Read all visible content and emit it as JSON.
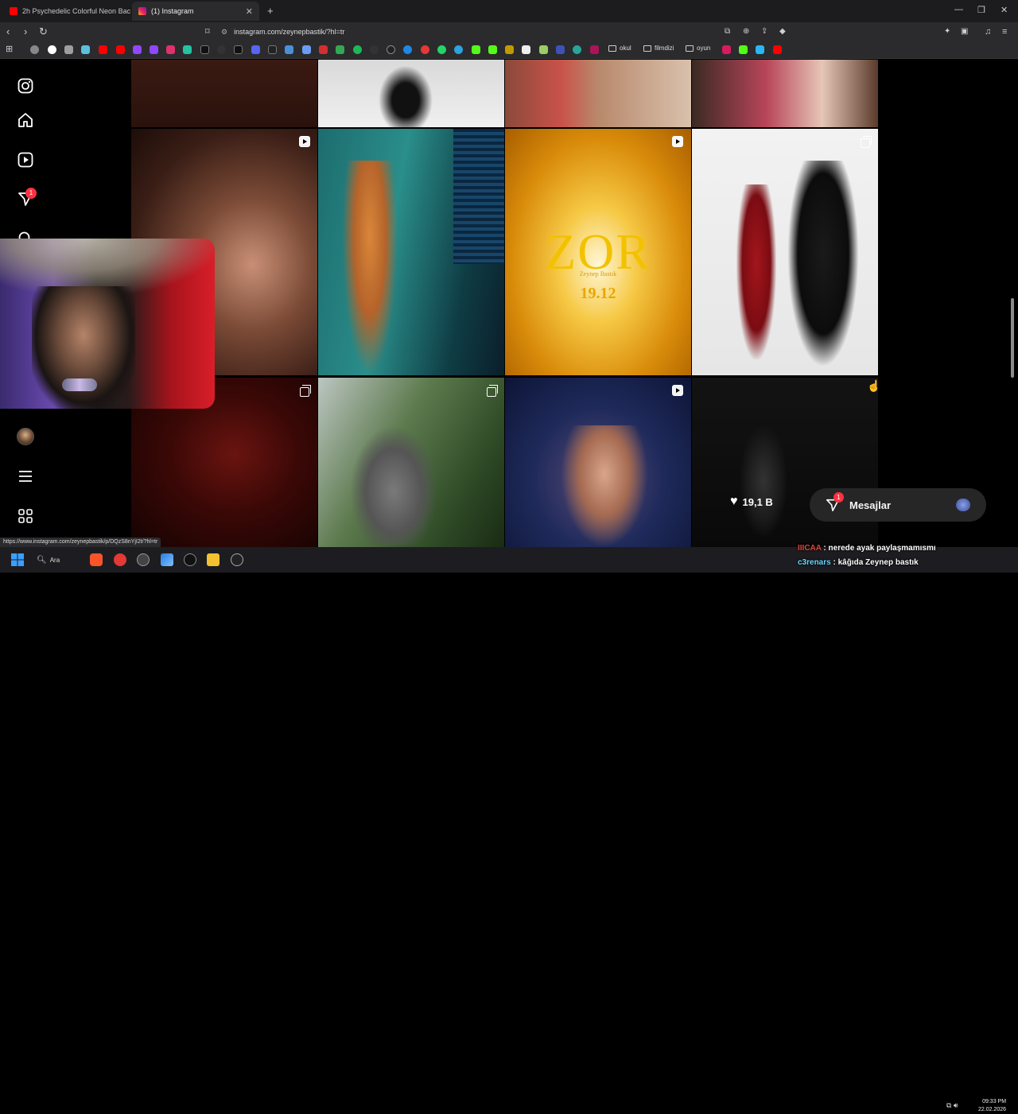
{
  "browser": {
    "tabs": [
      {
        "title": "2h Psychedelic Colorful Neon Backgr",
        "active": false
      },
      {
        "title": "(1) Instagram",
        "active": true
      }
    ],
    "url": "instagram.com/zeynepbastik/?hl=tr",
    "bookmark_folders": [
      "okul",
      "filmdizi",
      "oyun"
    ],
    "status_url": "https://www.instagram.com/zeynepbastik/p/DQzS8nYjI2t/?hl=tr"
  },
  "sidebar": {
    "notification_count": "1",
    "icons": [
      "instagram-logo-icon",
      "home-icon",
      "reels-icon",
      "messages-icon",
      "search-icon",
      "profile-avatar",
      "menu-icon",
      "apps-icon"
    ]
  },
  "grid": {
    "featured_post_title": "ZOR",
    "featured_post_subtitle": "Zeynep Bastık",
    "featured_post_date": "19.12",
    "hover_likes": "19,1 B"
  },
  "messages": {
    "label": "Mesajlar",
    "badge": "1"
  },
  "taskbar": {
    "search_label": "Ara",
    "time": "09:33 PM",
    "date": "22.02.2026"
  },
  "chat": [
    {
      "user": "IIICAA",
      "message": ": nerede ayak paylaşmamısmı"
    },
    {
      "user": "c3renars",
      "message": ": kâğıda Zeynep bastık"
    }
  ],
  "colors": {
    "chat_user1": "#e0453a",
    "chat_user2": "#6bd6ff",
    "notification": "#ff3040"
  }
}
